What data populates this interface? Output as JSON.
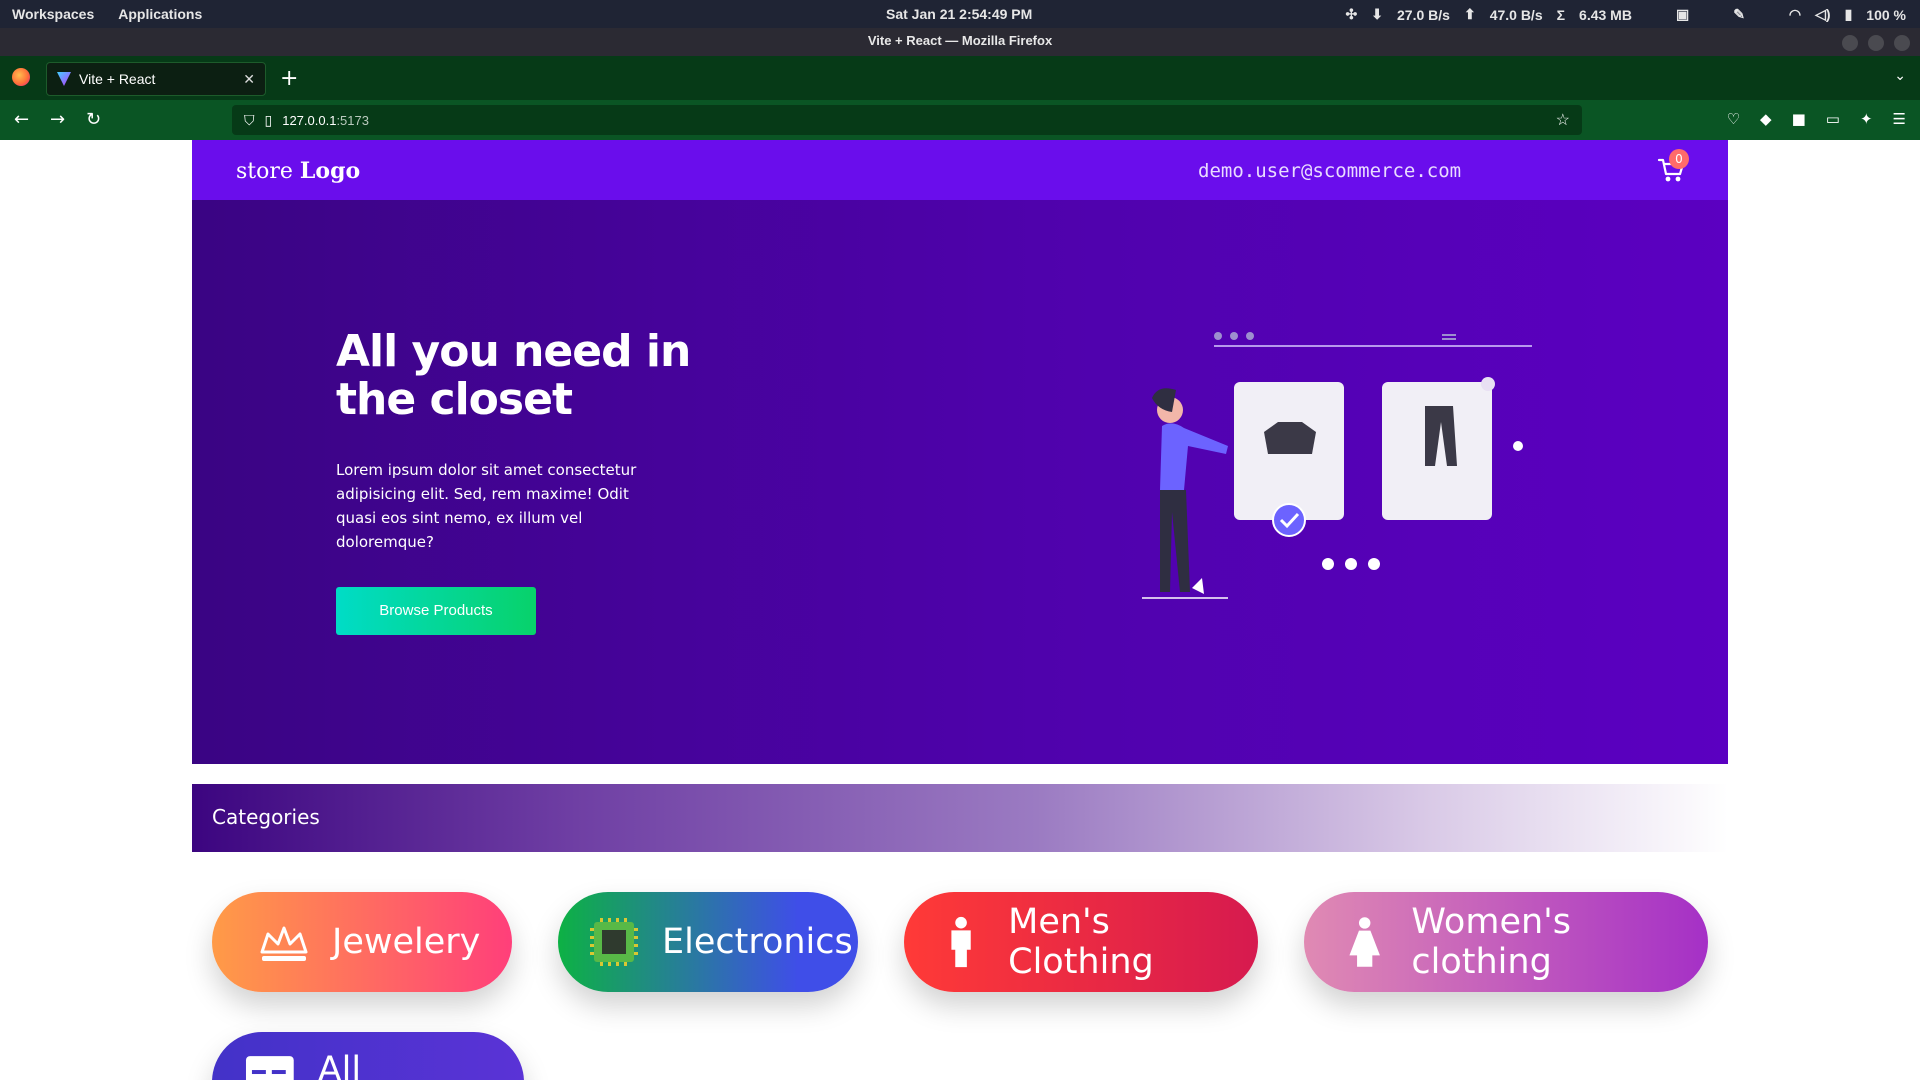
{
  "os": {
    "workspaces": "Workspaces",
    "applications": "Applications",
    "clock": "Sat Jan 21   2:54:49 PM",
    "net_down": "27.0 B/s",
    "net_up": "47.0 B/s",
    "net_total": "6.43 MB",
    "battery": "100 %"
  },
  "browser": {
    "window_title": "Vite + React — Mozilla Firefox",
    "tab_title": "Vite + React",
    "url_host": "127.0.0.1",
    "url_port": ":5173"
  },
  "site": {
    "logo_prefix": "store",
    "logo_bold": "Logo",
    "user_email": "demo.user@scommerce.com",
    "cart_count": "0",
    "colors": {
      "header": "#6a0dec",
      "hero": "#4f02ac",
      "cta": "#00dcc7"
    }
  },
  "hero": {
    "title": "All you need in the closet",
    "text": "Lorem ipsum dolor sit amet consectetur adipisicing elit. Sed, rem maxime! Odit quasi eos sint nemo, ex illum vel doloremque?",
    "button": "Browse Products"
  },
  "categories": {
    "heading": "Categories",
    "items": [
      {
        "label": "Jewelery",
        "icon": "crown-icon"
      },
      {
        "label": "Electronics",
        "icon": "chip-icon"
      },
      {
        "label": "Men's Clothing",
        "icon": "man-icon"
      },
      {
        "label": "Women's clothing",
        "icon": "woman-icon"
      },
      {
        "label": "All products",
        "icon": "store-icon"
      }
    ]
  }
}
